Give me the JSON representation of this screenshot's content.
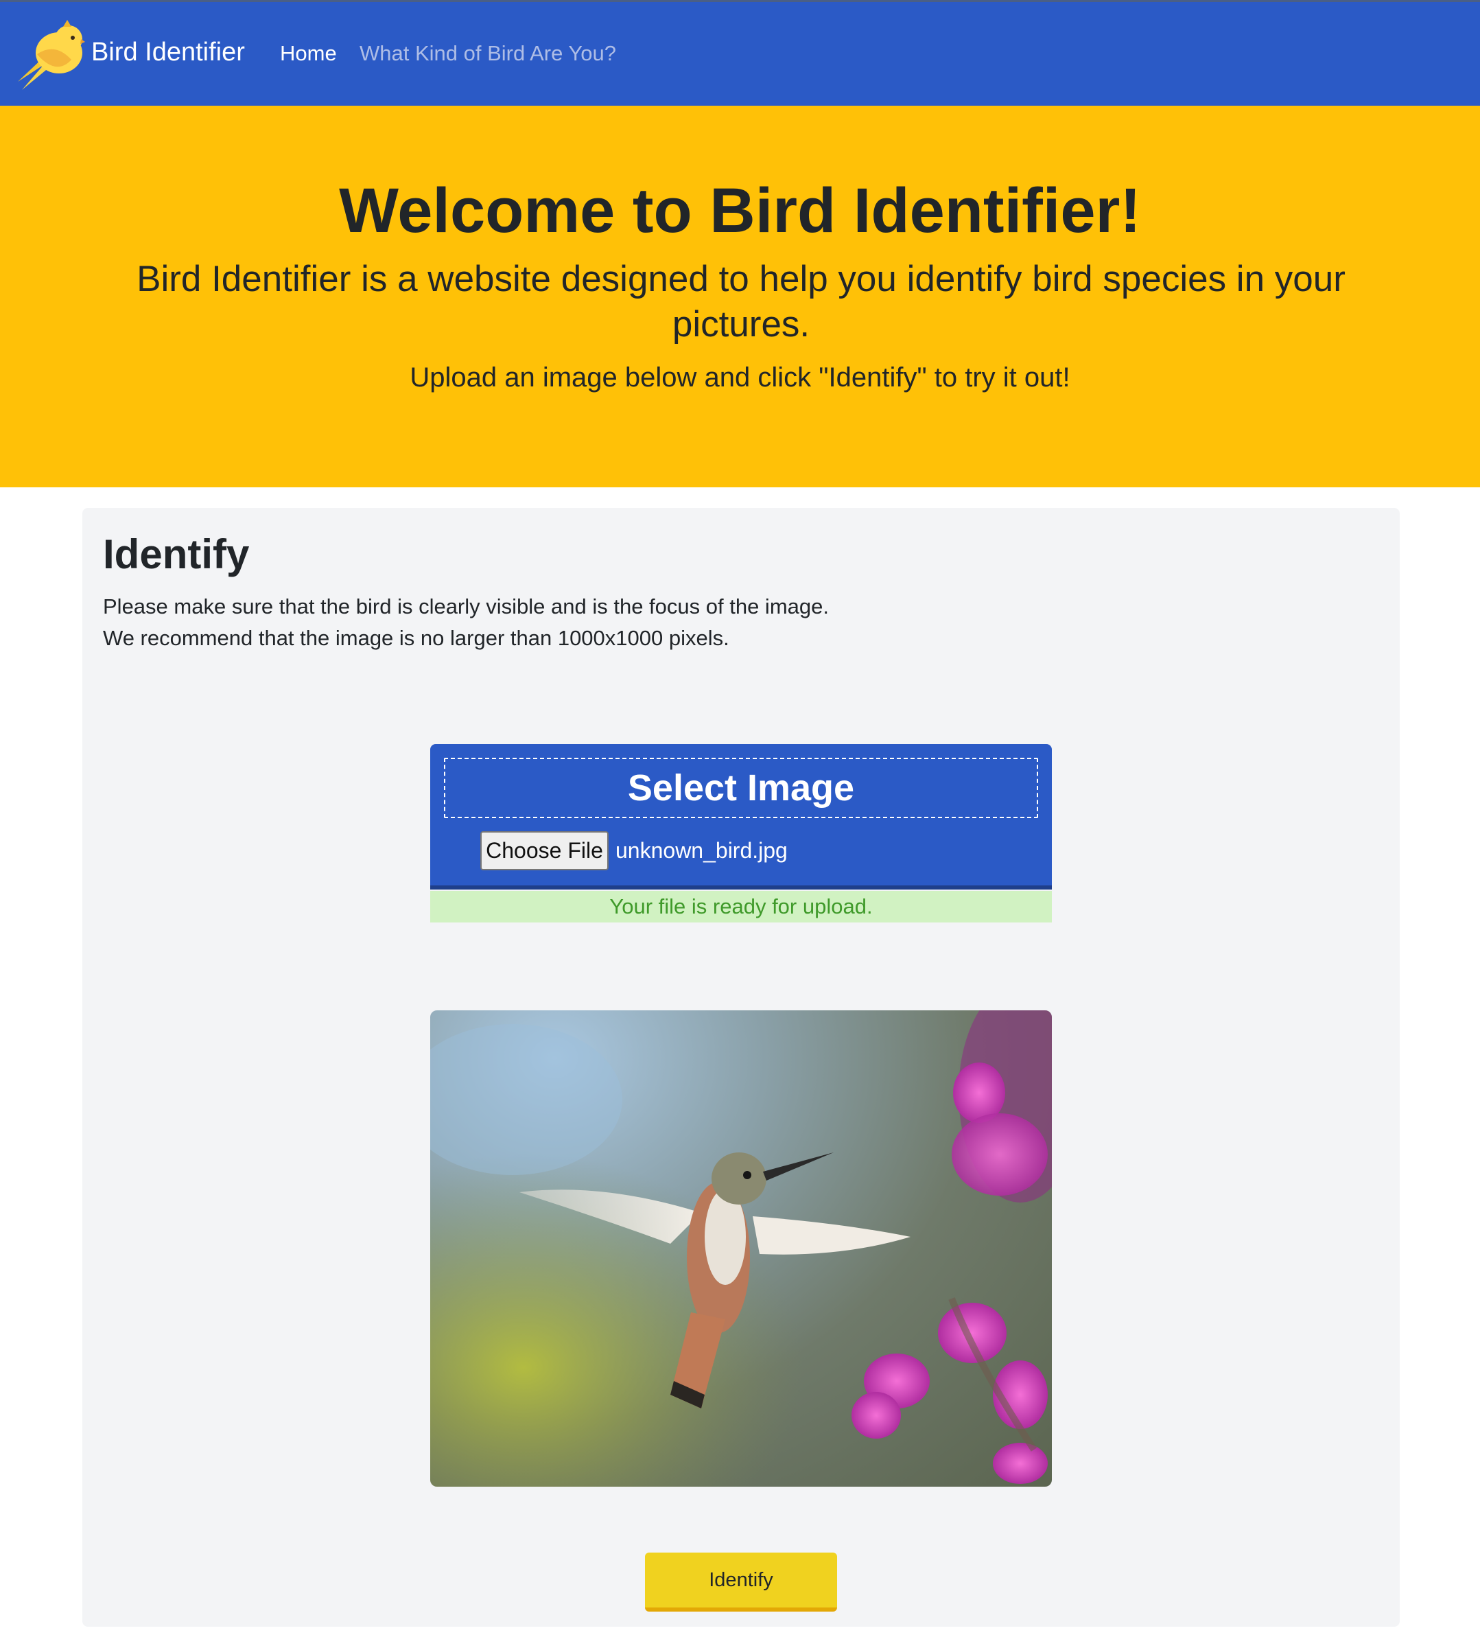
{
  "navbar": {
    "brand": "Bird Identifier",
    "links": [
      {
        "label": "Home"
      },
      {
        "label": "What Kind of Bird Are You?"
      }
    ]
  },
  "hero": {
    "title": "Welcome to Bird Identifier!",
    "subtitle": "Bird Identifier is a website designed to help you identify bird species in your pictures.",
    "instruction": "Upload an image below and click \"Identify\" to try it out!"
  },
  "identify": {
    "heading": "Identify",
    "tip_1": "Please make sure that the bird is clearly visible and is the focus of the image.",
    "tip_2": "We recommend that the image is no larger than 1000x1000 pixels.",
    "upload_label": "Select Image",
    "choose_file": "Choose File",
    "file_name": "unknown_bird.jpg",
    "status": "Your file is ready for upload.",
    "button": "Identify"
  },
  "colors": {
    "navbar": "#2b5ac6",
    "hero": "#ffc107",
    "card": "#f3f4f6",
    "success_bg": "#d1f2c2",
    "success_text": "#3f9a2a",
    "button": "#f0d21f"
  },
  "icons": {
    "logo": "bird-logo-icon"
  }
}
